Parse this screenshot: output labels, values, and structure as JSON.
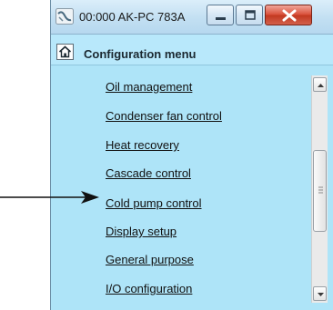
{
  "window": {
    "title": "00:000 AK-PC 783A",
    "buttons": {
      "minimize": "minimize-icon",
      "maximize": "maximize-icon",
      "close": "close-icon"
    }
  },
  "header": {
    "title": "Configuration menu",
    "home_icon": "home-icon"
  },
  "menu": {
    "items": [
      "Oil management",
      "Condenser fan control",
      "Heat recovery",
      "Cascade control",
      "Cold pump control",
      "Display setup",
      "General purpose",
      "I/O configuration"
    ],
    "pointed_item": "Cold pump control"
  },
  "colors": {
    "background": "#aee4f8",
    "header": "#b8e8fb",
    "close_button": "#c9452e"
  }
}
